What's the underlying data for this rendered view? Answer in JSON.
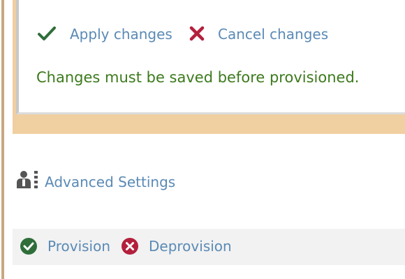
{
  "toolbar": {
    "apply_label": "Apply changes",
    "cancel_label": "Cancel changes"
  },
  "status_message": "Changes must be saved before provisioned.",
  "advanced": {
    "label": "Advanced Settings"
  },
  "actions": {
    "provision_label": "Provision",
    "deprovision_label": "Deprovision"
  },
  "colors": {
    "link": "#5a8ab5",
    "status_green": "#3c7a1c",
    "check_green": "#2f6e3a",
    "cancel_red": "#b3203c",
    "band_tan": "#f0cfa0"
  },
  "icons": {
    "apply": "checkmark-icon",
    "cancel": "x-icon",
    "advanced": "user-settings-icon",
    "provision": "check-circle-icon",
    "deprovision": "x-circle-icon"
  }
}
